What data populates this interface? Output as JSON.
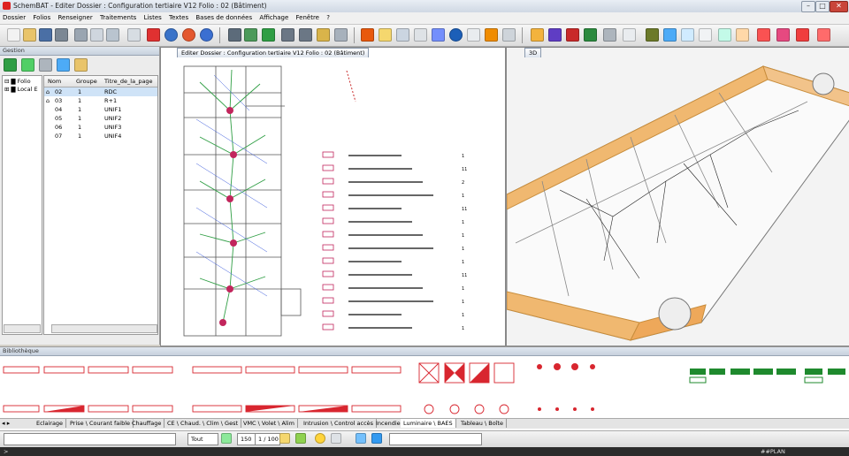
{
  "titlebar": {
    "title": "SchemBAT - Editer Dossier : Configuration tertiaire V12  Folio : 02 (Bâtiment)"
  },
  "menu": [
    "Dossier",
    "Folios",
    "Renseigner",
    "Traitements",
    "Listes",
    "Textes",
    "Bases de données",
    "Affichage",
    "Fenêtre",
    "?"
  ],
  "left_panel": {
    "title": "Gestion",
    "tree": [
      "Folio",
      "Local E"
    ],
    "grid_headers": [
      "Nom",
      "Groupe",
      "Titre_de_la_page"
    ],
    "rows": [
      {
        "nom": "02",
        "groupe": "1",
        "titre": "RDC"
      },
      {
        "nom": "03",
        "groupe": "1",
        "titre": "R+1"
      },
      {
        "nom": "04",
        "groupe": "1",
        "titre": "UNIF1"
      },
      {
        "nom": "05",
        "groupe": "1",
        "titre": "UNIF2"
      },
      {
        "nom": "06",
        "groupe": "1",
        "titre": "UNIF3"
      },
      {
        "nom": "07",
        "groupe": "1",
        "titre": "UNIF4"
      }
    ]
  },
  "views": {
    "drawing_tab": "Editer  Dossier : Configuration tertiaire V12  Folio : 02 (Bâtiment)",
    "view3d_tab": "3D"
  },
  "legend_counts": [
    "1",
    "11",
    "2",
    "1",
    "11",
    "1",
    "1",
    "1",
    "1",
    "11",
    "1",
    "1",
    "1",
    "1"
  ],
  "library": {
    "title": "Bibliothèque",
    "tabs": [
      "Eclairage",
      "Prise \\ Courant faible",
      "Chauffage",
      "CE \\ Chaud. \\ Clim \\ Gest",
      "VMC \\ Volet \\ Alim",
      "Intrusion \\ Control accès",
      "Incendie",
      "Luminaire \\ BAES",
      "Tableau \\ Boîte"
    ],
    "active_tab": "Luminaire \\ BAES"
  },
  "bottom": {
    "filter": "Tout",
    "zoom": "150",
    "scale": "1 / 100"
  },
  "status": {
    "right": "##PLAN",
    "left": ">"
  },
  "colors": {
    "accent_red": "#d8262f",
    "green": "#1f8a2e",
    "wall_orange": "#f0b870"
  }
}
